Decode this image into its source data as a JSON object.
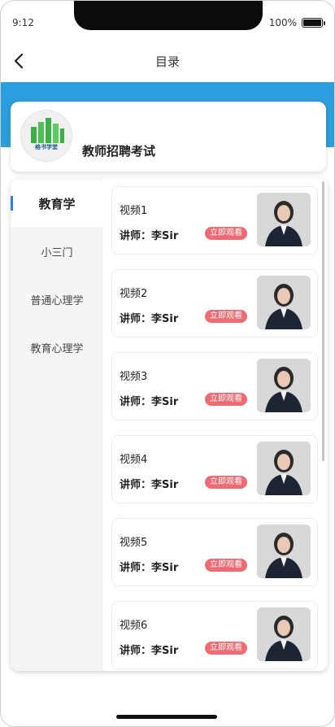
{
  "status_bar": {
    "time": "9:12",
    "battery": "100%",
    "battery_level": 1.0
  },
  "nav": {
    "title": "目录",
    "back_icon": "chevron-left-icon"
  },
  "course": {
    "title": "教师招聘考试",
    "logo_text": "格书学堂"
  },
  "categories": [
    {
      "label": "教育学",
      "active": true
    },
    {
      "label": "小三门",
      "active": false
    },
    {
      "label": "普通心理学",
      "active": false
    },
    {
      "label": "教育心理学",
      "active": false
    }
  ],
  "videos": [
    {
      "title": "视频1",
      "lecturer": "讲师：李Sir",
      "action": "立即观看"
    },
    {
      "title": "视频2",
      "lecturer": "讲师：李Sir",
      "action": "立即观看"
    },
    {
      "title": "视频3",
      "lecturer": "讲师：李Sir",
      "action": "立即观看"
    },
    {
      "title": "视频4",
      "lecturer": "讲师：李Sir",
      "action": "立即观看"
    },
    {
      "title": "视频5",
      "lecturer": "讲师：李Sir",
      "action": "立即观看"
    },
    {
      "title": "视频6",
      "lecturer": "讲师：李Sir",
      "action": "立即观看"
    }
  ],
  "colors": {
    "accent_blue": "#2a9ede",
    "badge_red": "#ef6a72",
    "active_indicator": "#3a7be0",
    "logo_green": "#3fae49"
  }
}
